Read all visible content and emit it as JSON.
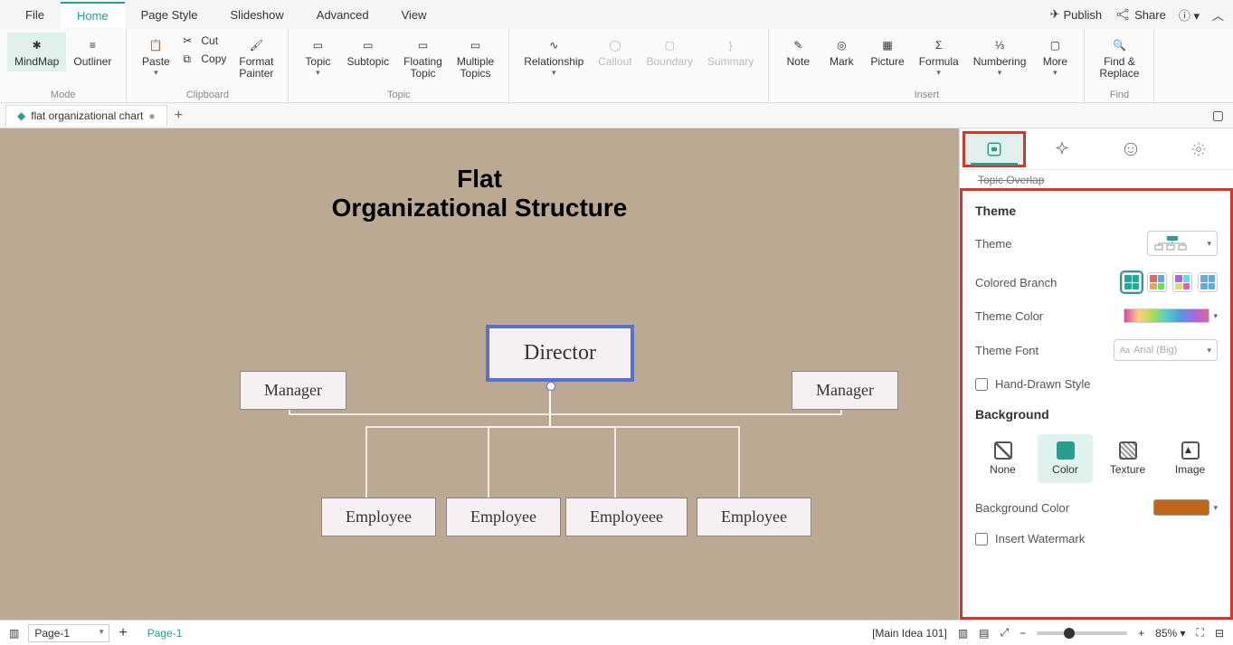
{
  "menu": {
    "file": "File",
    "home": "Home",
    "pagestyle": "Page Style",
    "slideshow": "Slideshow",
    "advanced": "Advanced",
    "view": "View",
    "publish": "Publish",
    "share": "Share"
  },
  "ribbon": {
    "mindmap": "MindMap",
    "outliner": "Outliner",
    "mode_lbl": "Mode",
    "paste": "Paste",
    "cut": "Cut",
    "copy": "Copy",
    "fmtpainter": "Format\nPainter",
    "clipboard_lbl": "Clipboard",
    "topic": "Topic",
    "subtopic": "Subtopic",
    "floating": "Floating\nTopic",
    "multiple": "Multiple\nTopics",
    "topic_lbl": "Topic",
    "relationship": "Relationship",
    "callout": "Callout",
    "boundary": "Boundary",
    "summary": "Summary",
    "note": "Note",
    "mark": "Mark",
    "picture": "Picture",
    "formula": "Formula",
    "numbering": "Numbering",
    "more": "More",
    "insert_lbl": "Insert",
    "findreplace": "Find &\nReplace",
    "find_lbl": "Find"
  },
  "doc_tab": "flat organizational chart",
  "canvas": {
    "title_l1": "Flat",
    "title_l2": "Organizational Structure",
    "director": "Director",
    "manager": "Manager",
    "emp1": "Employee",
    "emp2": "Employee",
    "emp3": "Employeee",
    "emp4": "Employee"
  },
  "side": {
    "topic_overlap": "Topic Overlap",
    "theme_hdr": "Theme",
    "theme_lbl": "Theme",
    "colored_branch": "Colored Branch",
    "theme_color": "Theme Color",
    "theme_font": "Theme Font",
    "font_placeholder": "Arial (Big)",
    "handdrawn": "Hand-Drawn Style",
    "bg_hdr": "Background",
    "bg_none": "None",
    "bg_color": "Color",
    "bg_texture": "Texture",
    "bg_image": "Image",
    "bg_color_lbl": "Background Color",
    "bg_color_val": "#c0661a",
    "watermark": "Insert Watermark"
  },
  "footer": {
    "page_sel": "Page-1",
    "page_tab": "Page-1",
    "main_idea": "[Main Idea 101]",
    "zoom": "85%"
  }
}
